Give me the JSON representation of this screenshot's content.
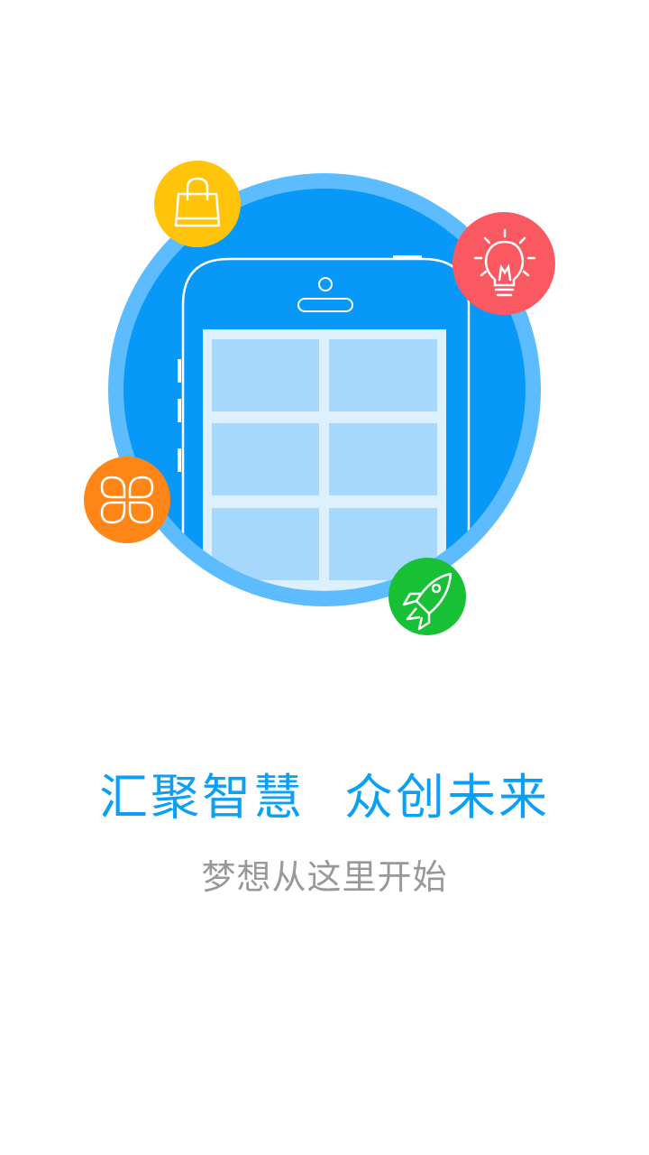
{
  "splash": {
    "headline_left": "汇聚智慧",
    "headline_right": "众创未来",
    "subline": "梦想从这里开始"
  },
  "colors": {
    "brand_blue": "#0aa0f5",
    "outer_ring": "#5cbcfd",
    "inner_circle": "#0898f8",
    "grid_tile": "#a6d8fd",
    "subline_gray": "#999999",
    "badge_yellow": "#ffc40a",
    "badge_red": "#fb5962",
    "badge_orange": "#fe8617",
    "badge_green": "#17c035"
  },
  "icons": {
    "top_left": "shopping-bag-icon",
    "top_right": "lightbulb-icon",
    "left": "clover-icon",
    "bottom": "rocket-icon",
    "center": "smartphone-icon"
  }
}
